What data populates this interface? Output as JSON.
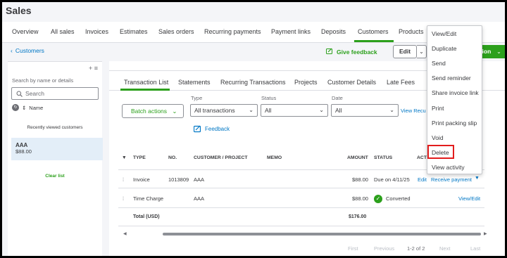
{
  "page": {
    "title": "Sales"
  },
  "topnav": {
    "tabs": [
      "Overview",
      "All sales",
      "Invoices",
      "Estimates",
      "Sales orders",
      "Recurring payments",
      "Payment links",
      "Deposits",
      "Customers",
      "Products"
    ],
    "active": "Customers"
  },
  "header": {
    "back_label": "Customers",
    "feedback_label": "Give feedback",
    "edit_label": "Edit",
    "new_transaction_label": "ction"
  },
  "sidebar": {
    "search_label": "Search by name or details",
    "search_placeholder": "Search",
    "sort_label": "Name",
    "recent_label": "Recently viewed customers",
    "customer_name": "AAA",
    "customer_amount": "$88.00",
    "clear_label": "Clear list"
  },
  "tabs": [
    "Transaction List",
    "Statements",
    "Recurring Transactions",
    "Projects",
    "Customer Details",
    "Late Fees"
  ],
  "filters": {
    "batch_label": "Batch actions",
    "type_label": "Type",
    "type_value": "All transactions",
    "status_label": "Status",
    "status_value": "All",
    "date_label": "Date",
    "date_value": "All",
    "view_recurring": "View Recu",
    "feedback_label": "Feedback"
  },
  "table": {
    "headers": [
      "TYPE",
      "NO.",
      "CUSTOMER / PROJECT",
      "MEMO",
      "AMOUNT",
      "STATUS",
      "ACTI"
    ],
    "rows": [
      {
        "type": "Invoice",
        "no": "1013809",
        "customer": "AAA",
        "memo": "",
        "amount": "$88.00",
        "status": "Due on 4/11/25",
        "action_edit": "Edit",
        "action_main": "Receive payment"
      },
      {
        "type": "Time Charge",
        "no": "",
        "customer": "AAA",
        "memo": "",
        "amount": "$88.00",
        "status": "Converted",
        "action_main": "View/Edit"
      }
    ],
    "total_label": "Total (USD)",
    "total_amount": "$176.00"
  },
  "pagination": {
    "first": "First",
    "previous": "Previous",
    "range": "1-2 of 2",
    "next": "Next",
    "last": "Last"
  },
  "action_menu": {
    "items": [
      "View/Edit",
      "Duplicate",
      "Send",
      "Send reminder",
      "Share invoice link",
      "Print",
      "Print packing slip",
      "Void",
      "Delete",
      "View activity"
    ],
    "highlighted": "Delete"
  },
  "colors": {
    "accent_green": "#2ca01c",
    "link_blue": "#0077c5",
    "highlight_red": "#e21d1d"
  }
}
